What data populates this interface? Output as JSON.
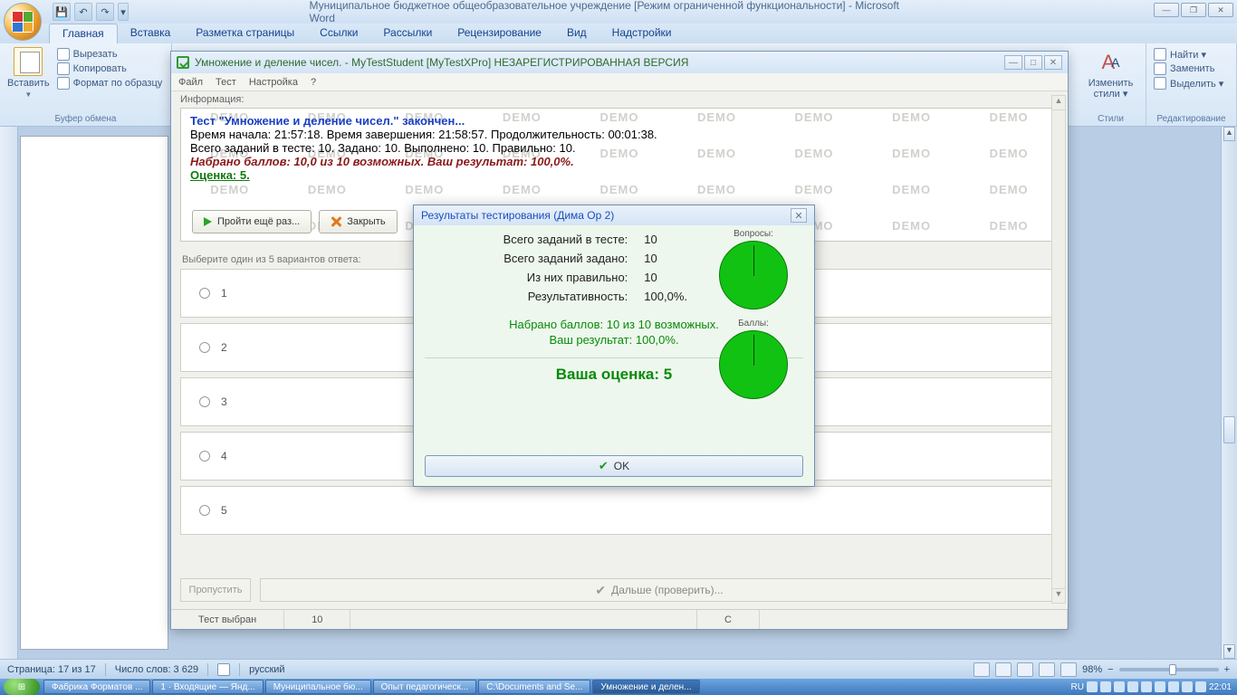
{
  "word": {
    "title": "Муниципальное бюджетное общеобразовательное учреждение [Режим ограниченной функциональности] - Microsoft Word",
    "tabs": [
      "Главная",
      "Вставка",
      "Разметка страницы",
      "Ссылки",
      "Рассылки",
      "Рецензирование",
      "Вид",
      "Надстройки"
    ],
    "clipboard": {
      "paste": "Вставить",
      "cut": "Вырезать",
      "copy": "Копировать",
      "format": "Формат по образцу",
      "group": "Буфер обмена"
    },
    "styles": {
      "change": "Изменить стили ▾",
      "group": "Стили"
    },
    "editing": {
      "find": "Найти ▾",
      "replace": "Заменить",
      "select": "Выделить ▾",
      "group": "Редактирование"
    },
    "status": {
      "page": "Страница: 17 из 17",
      "words": "Число слов: 3 629",
      "lang": "русский",
      "zoom": "98%"
    }
  },
  "mytest": {
    "title": "Умножение и деление чисел. - MyTestStudent [MyTestXPro] НЕЗАРЕГИСТРИРОВАННАЯ ВЕРСИЯ",
    "menu": [
      "Файл",
      "Тест",
      "Настройка",
      "?"
    ],
    "info_label": "Информация:",
    "demo": "DEMO",
    "line1": "Тест \"Умножение и деление чисел.\" закончен...",
    "line2": "Время начала: 21:57:18. Время завершения: 21:58:57. Продолжительность: 00:01:38.",
    "line3": "Всего заданий в тесте: 10. Задано: 10. Выполнено: 10. Правильно: 10.",
    "line4": "Набрано баллов: 10,0 из 10 возможных. Ваш результат: 100,0%.",
    "line5": "Оценка: 5.",
    "btn_again": "Пройти ещё раз...",
    "btn_close": "Закрыть",
    "prompt": "Выберите один из 5 вариантов ответа:",
    "answers": [
      "1",
      "2",
      "3",
      "4",
      "5"
    ],
    "skip": "Пропустить",
    "check": "Дальше (проверить)...",
    "status_left": "Тест выбран",
    "status_num": "10",
    "status_c": "С"
  },
  "dialog": {
    "title": "Результаты тестирования (Дима Ор 2)",
    "rows": [
      {
        "lab": "Всего заданий в тесте:",
        "val": "10"
      },
      {
        "lab": "Всего заданий задано:",
        "val": "10"
      },
      {
        "lab": "Из них правильно:",
        "val": "10"
      },
      {
        "lab": "Результативность:",
        "val": "100,0%."
      }
    ],
    "pie1": "Вопросы:",
    "pie2": "Баллы:",
    "msg1": "Набрано баллов: 10 из 10 возможных.",
    "msg2": "Ваш результат: 100,0%.",
    "grade": "Ваша оценка: 5",
    "ok": "OK"
  },
  "taskbar": {
    "items": [
      "Фабрика Форматов ...",
      "1 · Входящие — Янд...",
      "Муниципальное бю...",
      "Опыт педагогическ...",
      "C:\\Documents and Se...",
      "Умножение и делен..."
    ],
    "lang": "RU",
    "clock": "22:01"
  }
}
